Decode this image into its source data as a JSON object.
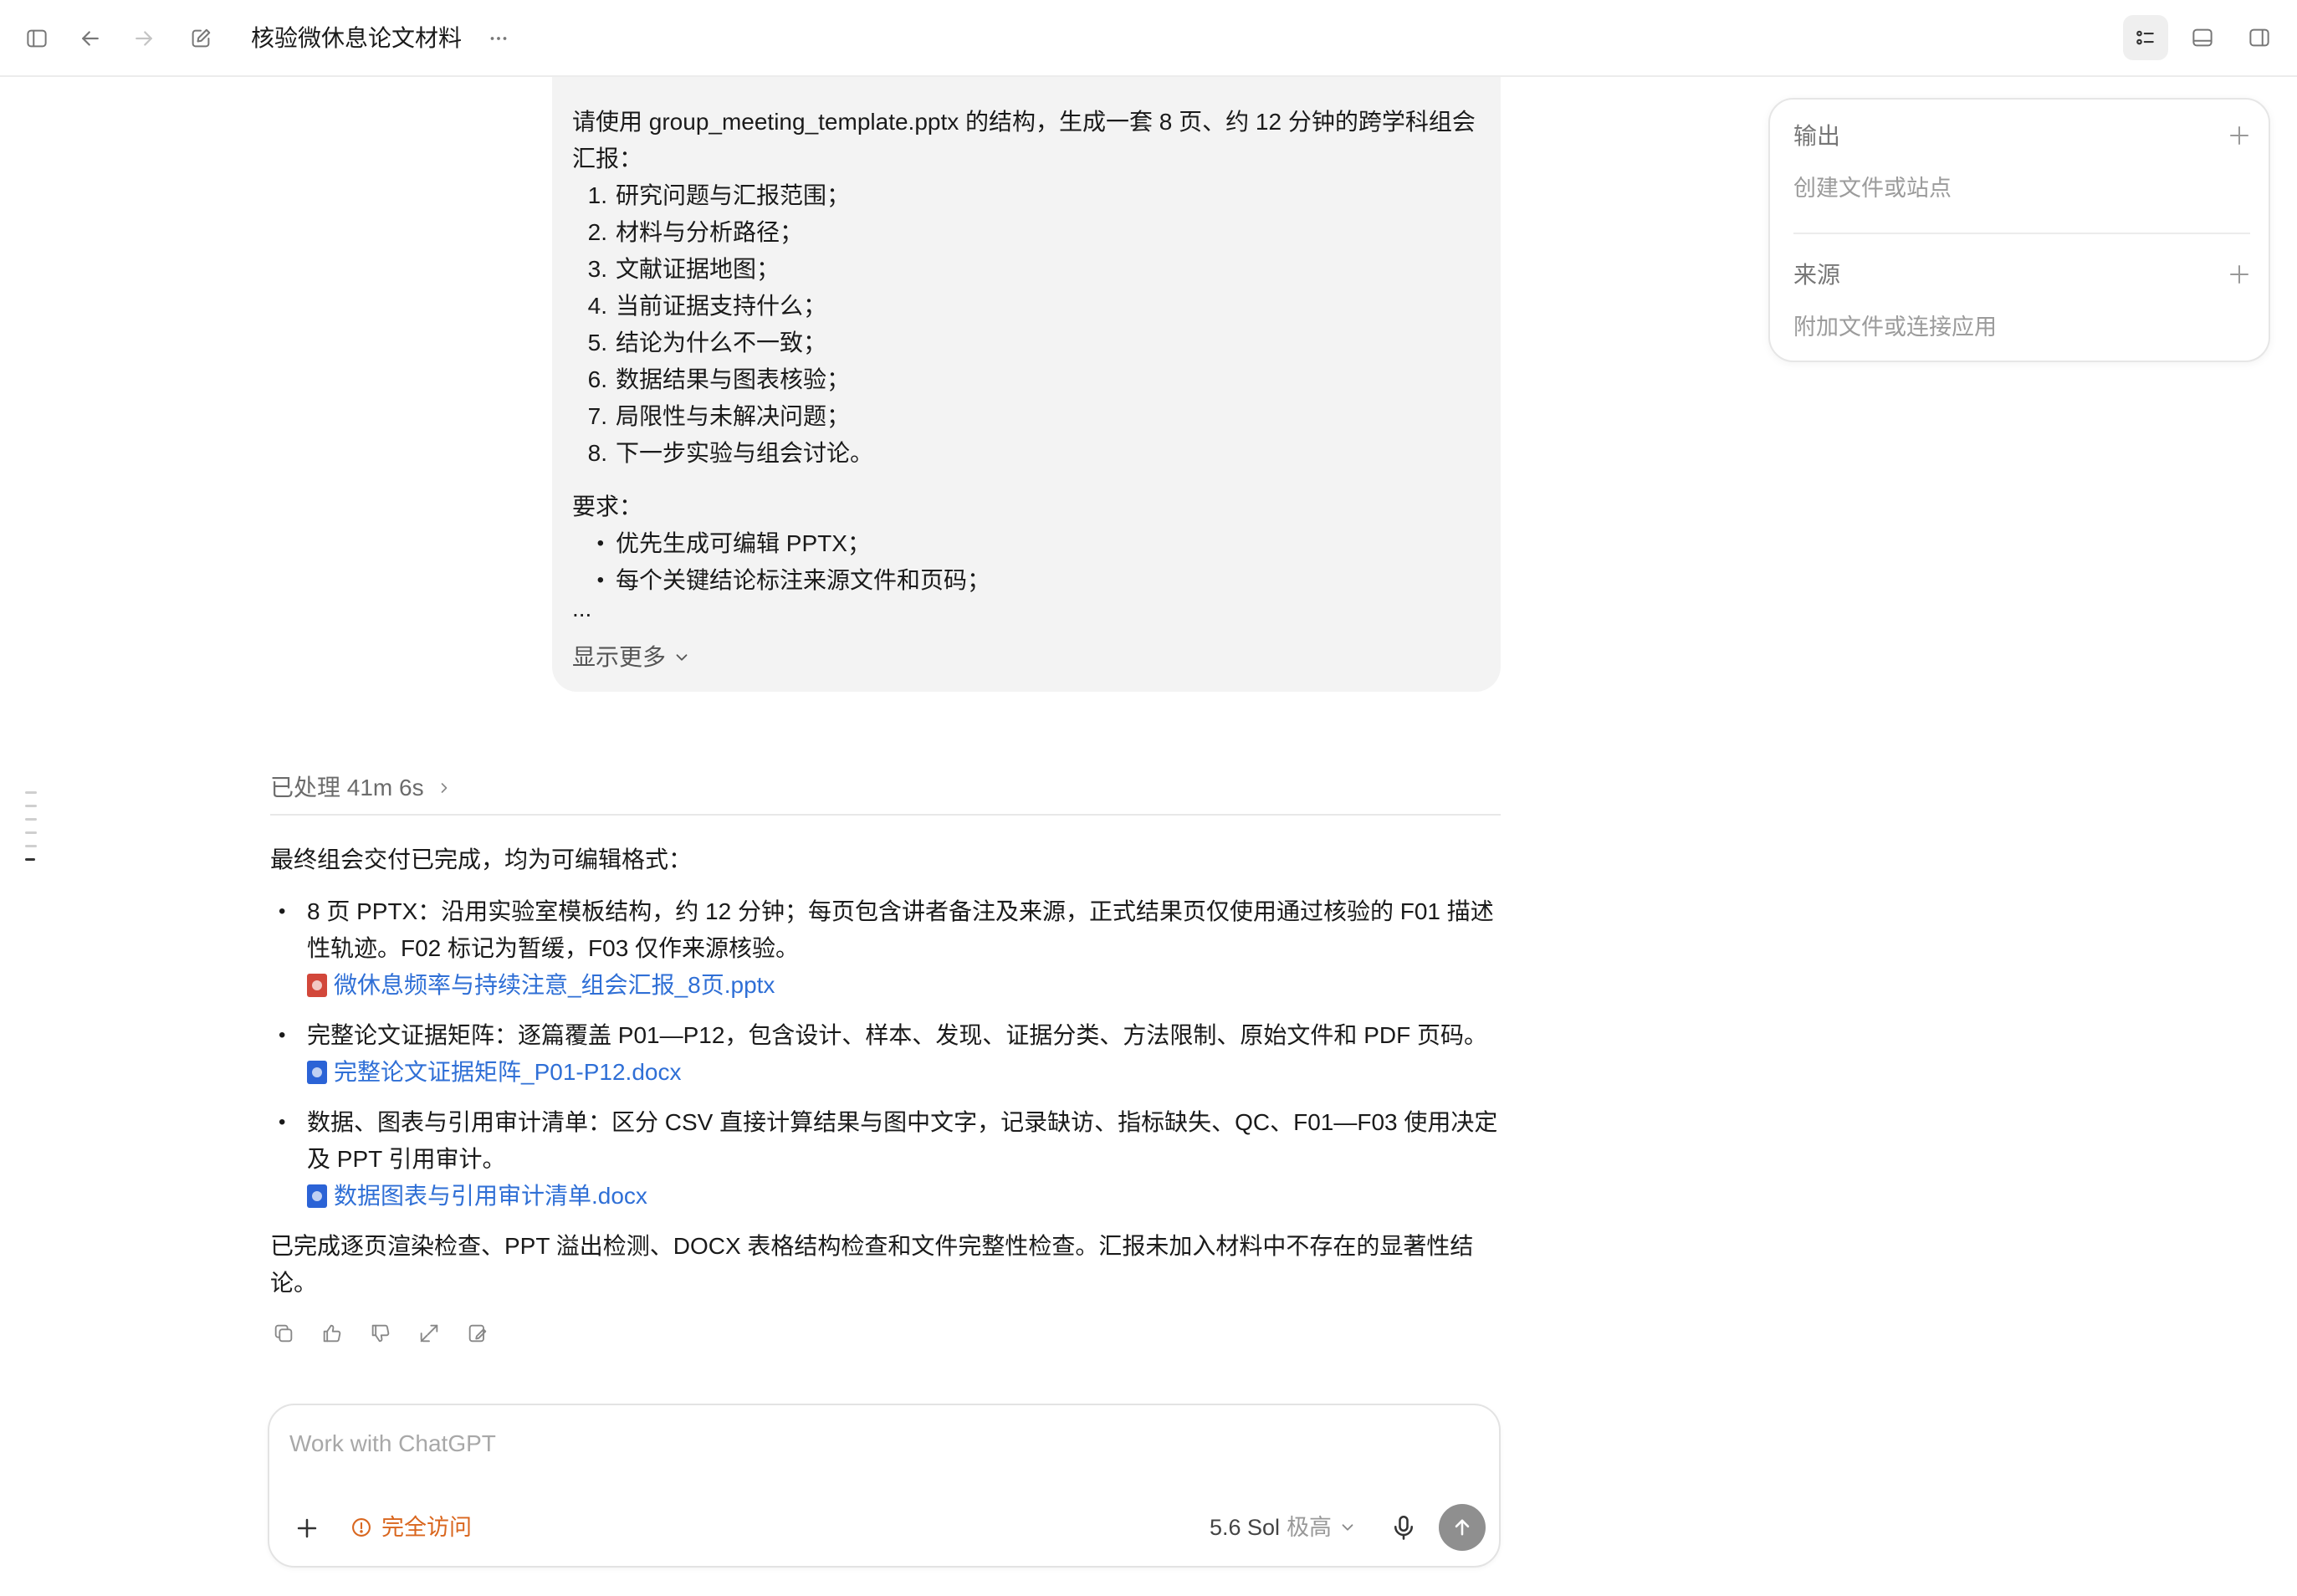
{
  "window": {
    "title": "核验微休息论文材料"
  },
  "user_message": {
    "intro": "请使用 group_meeting_template.pptx 的结构，生成一套 8 页、约 12 分钟的跨学科组会汇报：",
    "items": [
      {
        "num": "1.",
        "text": "研究问题与汇报范围；"
      },
      {
        "num": "2.",
        "text": "材料与分析路径；"
      },
      {
        "num": "3.",
        "text": "文献证据地图；"
      },
      {
        "num": "4.",
        "text": "当前证据支持什么；"
      },
      {
        "num": "5.",
        "text": "结论为什么不一致；"
      },
      {
        "num": "6.",
        "text": "数据结果与图表核验；"
      },
      {
        "num": "7.",
        "text": "局限性与未解决问题；"
      },
      {
        "num": "8.",
        "text": "下一步实验与组会讨论。"
      }
    ],
    "requirements_label": "要求：",
    "requirements": [
      {
        "text": "优先生成可编辑 PPTX；"
      },
      {
        "text": "每个关键结论标注来源文件和页码；"
      }
    ],
    "ellipsis": "...",
    "show_more": "显示更多"
  },
  "processed": {
    "label": "已处理 41m 6s"
  },
  "answer": {
    "intro": "最终组会交付已完成，均为可编辑格式：",
    "bullets": [
      {
        "text": "8 页 PPTX：沿用实验室模板结构，约 12 分钟；每页包含讲者备注及来源，正式结果页仅使用通过核验的 F01 描述性轨迹。F02 标记为暂缓，F03 仅作来源核验。",
        "file": "微休息频率与持续注意_组会汇报_8页.pptx"
      },
      {
        "text": "完整论文证据矩阵：逐篇覆盖 P01—P12，包含设计、样本、发现、证据分类、方法限制、原始文件和 PDF 页码。",
        "file": "完整论文证据矩阵_P01-P12.docx"
      },
      {
        "text": "数据、图表与引用审计清单：区分 CSV 直接计算结果与图中文字，记录缺访、指标缺失、QC、F01—F03 使用决定及 PPT 引用审计。",
        "file": "数据图表与引用审计清单.docx"
      }
    ],
    "closing": "已完成逐页渲染检查、PPT 溢出检测、DOCX 表格结构检查和文件完整性检查。汇报未加入材料中不存在的显著性结论。"
  },
  "composer": {
    "placeholder": "Work with ChatGPT",
    "access_label": "完全访问",
    "model_name": "5.6 Sol",
    "model_level": "极高"
  },
  "side_panel": {
    "output_title": "输出",
    "output_sub": "创建文件或站点",
    "source_title": "来源",
    "source_sub": "附加文件或连接应用"
  },
  "colors": {
    "accent_link": "#2f6fd6",
    "access_warning": "#d9661e",
    "bubble_bg": "#f3f3f3"
  }
}
